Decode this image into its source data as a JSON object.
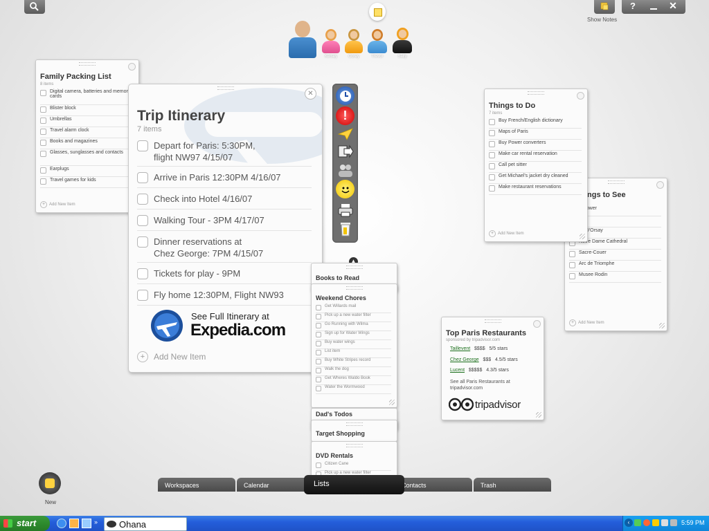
{
  "top_right": {
    "show_notes_label": "Show Notes"
  },
  "people": [
    "Kelsey",
    "Corey",
    "Trevor",
    "Sally"
  ],
  "family_packing": {
    "title": "Family Packing List",
    "count": "8 items",
    "items": [
      "Digital camera, batteries and memory cards",
      "Blister block",
      "Umbrellas",
      "Travel alarm clock",
      "Books and magazines",
      "Glasses, sunglasses and contacts",
      "Earplugs",
      "Travel games for kids"
    ],
    "add": "Add New Item"
  },
  "trip": {
    "title": "Trip Itinerary",
    "count": "7 items",
    "items": [
      {
        "line1": "Depart for Paris: 5:30PM,",
        "line2": "flight NW97    4/15/07"
      },
      {
        "line1": "Arrive in Paris 12:30PM     4/16/07",
        "line2": ""
      },
      {
        "line1": "Check into Hotel     4/16/07",
        "line2": ""
      },
      {
        "line1": "Walking Tour - 3PM     4/17/07",
        "line2": ""
      },
      {
        "line1": "Dinner reservations at",
        "line2": "Chez George: 7PM     4/15/07"
      },
      {
        "line1": "Tickets for play - 9PM",
        "line2": ""
      },
      {
        "line1": "Fly home 12:30PM, Flight NW93",
        "line2": ""
      }
    ],
    "promo_line1": "See Full Itinerary at",
    "promo_line2": "Expedia.com",
    "add": "Add New Item"
  },
  "things_to_do": {
    "title": "Things to Do",
    "count": "7 items",
    "items": [
      "Buy French/English dictionary",
      "Maps of Paris",
      "Buy Power converters",
      "Make car rental reservation",
      "Call pet sitter",
      "Get Michael's jacket dry cleaned",
      "Make restaurant reservations"
    ],
    "add": "Add New Item"
  },
  "things_to_see": {
    "title": "ngs to See",
    "items": [
      "el Tower",
      "vre",
      "ee D'Orsay",
      "Notre Dame Cathedral",
      "Sacre-Couer",
      "Arc de Triomphe",
      "Musee Rodin"
    ],
    "add": "Add New Item"
  },
  "stack": {
    "books": "Books to Read",
    "weekend": {
      "title": "Weekend Chores",
      "items": [
        "Get Willards mail",
        "Pick up a new water filter",
        "Go Running with Wilma",
        "Sign up for Water Wings",
        "Buy water wings",
        "List item",
        "Buy White Stripes record",
        "Walk the dog",
        "Get Wheres Waldo Book",
        "Water the Wormwood"
      ]
    },
    "dads": "Dad's Todos",
    "target": "Target Shopping",
    "dvd": {
      "title": "DVD Rentals",
      "items": [
        "Citizen Cane",
        "Pick up a new water filter"
      ]
    }
  },
  "restaurants": {
    "title": "Top Paris Restaurants",
    "sponsor": "sponsored by tripadvisor.com",
    "rows": [
      {
        "name": "Taillevent",
        "price": "$$$$",
        "rating": "5/5 stars"
      },
      {
        "name": "Chez George",
        "price": "$$$",
        "rating": "4.5/5 stars"
      },
      {
        "name": "Lucent",
        "price": "$$$$$",
        "rating": "4.3/5 stars"
      }
    ],
    "see_all": "See all Paris Restaurants at tripadvisor.com",
    "logo_text": "tripadvisor"
  },
  "new_label": "New",
  "tabs": [
    "Workspaces",
    "Calendar",
    "Lists",
    "Contacts",
    "Trash"
  ],
  "taskbar": {
    "start": "start",
    "window": "Ohana",
    "clock": "5:59 PM"
  }
}
